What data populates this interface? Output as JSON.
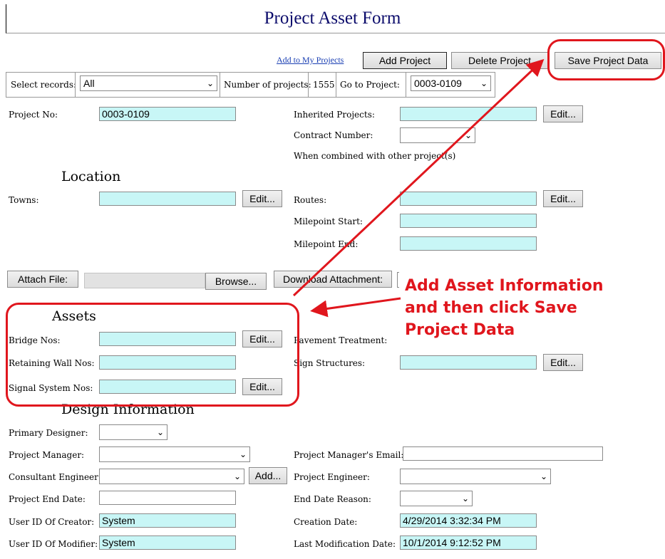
{
  "title": "Project Asset Form",
  "toolbar": {
    "add_to_my_projects": "Add to My Projects",
    "add_project": "Add Project",
    "delete_project": "Delete Project",
    "save_project_data": "Save Project Data"
  },
  "records_bar": {
    "select_records_label": "Select records:",
    "select_records_value": "All",
    "num_projects_label": "Number of projects:",
    "num_projects_value": "1555",
    "goto_label": "Go to Project:",
    "goto_value": "0003-0109"
  },
  "project": {
    "project_no_label": "Project No:",
    "project_no_value": "0003-0109",
    "inherited_label": "Inherited Projects:",
    "contract_label": "Contract Number:",
    "combined_note": "When combined with other project(s)"
  },
  "location": {
    "heading": "Location",
    "towns_label": "Towns:",
    "routes_label": "Routes:",
    "milepoint_start_label": "Milepoint Start:",
    "milepoint_end_label": "Milepoint End:"
  },
  "attach": {
    "attach_file": "Attach File:",
    "browse": "Browse...",
    "download": "Download Attachment:"
  },
  "assets": {
    "heading": "Assets",
    "bridge_label": "Bridge Nos:",
    "retaining_label": "Retaining Wall Nos:",
    "signal_label": "Signal System Nos:",
    "pavement_label": "Pavement Treatment:",
    "sign_label": "Sign Structures:"
  },
  "design": {
    "heading": "Design Information",
    "primary_designer_label": "Primary Designer:",
    "project_manager_label": "Project Manager:",
    "pm_email_label": "Project Manager's Email:",
    "consultant_label": "Consultant Engineer:",
    "project_engineer_label": "Project Engineer:",
    "end_date_label": "Project End Date:",
    "end_date_reason_label": "End Date Reason:",
    "creator_label": "User ID Of Creator:",
    "creator_value": "System",
    "creation_date_label": "Creation Date:",
    "creation_date_value": "4/29/2014 3:32:34 PM",
    "modifier_label": "User ID Of Modifier:",
    "modifier_value": "System",
    "last_mod_label": "Last Modification Date:",
    "last_mod_value": "10/1/2014 9:12:52 PM"
  },
  "common": {
    "edit": "Edit...",
    "add": "Add..."
  },
  "callout": {
    "line1": "Add Asset Information",
    "line2": "and then click Save",
    "line3": "Project Data"
  },
  "colors": {
    "accent_red": "#e0161d",
    "field_cyan": "#c8f6f6",
    "title_navy": "#0b0b6b"
  }
}
